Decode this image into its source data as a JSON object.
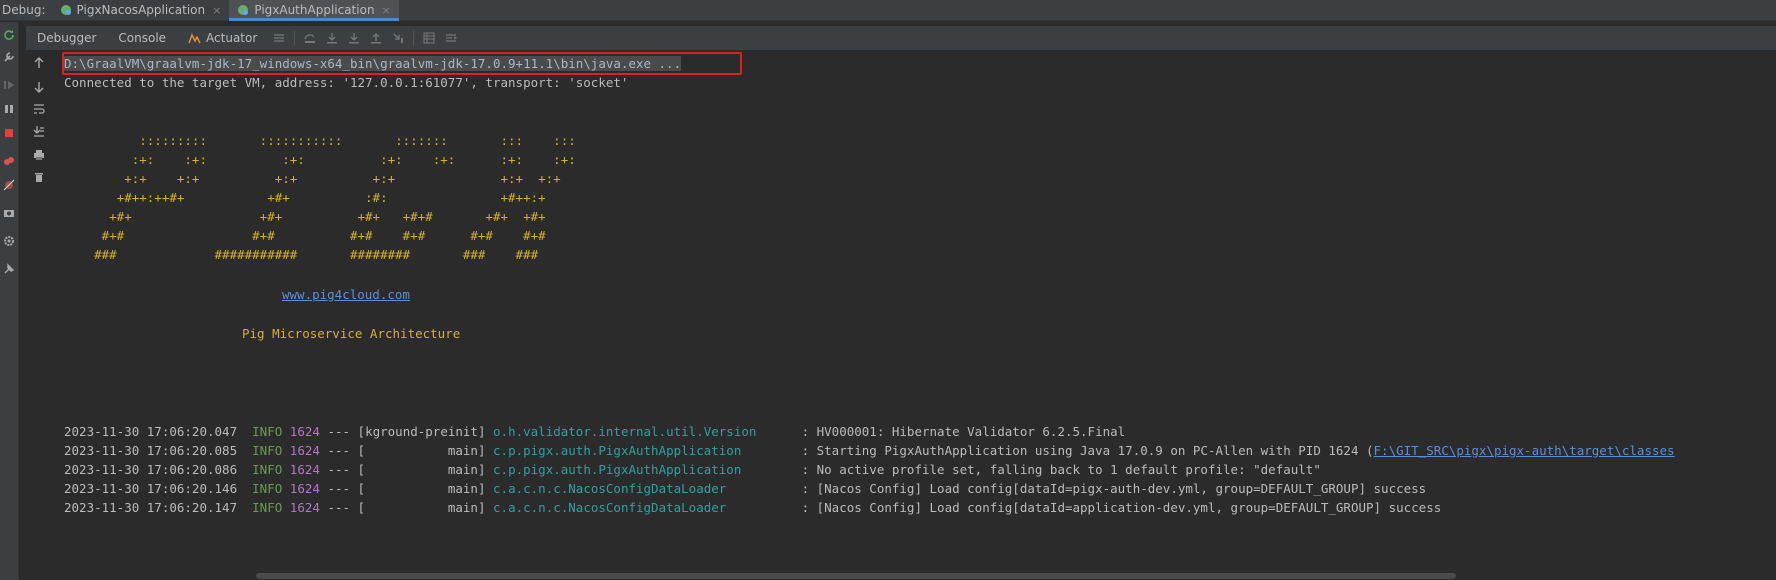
{
  "tabbar": {
    "debug_label": "Debug:",
    "tabs": [
      {
        "label": "PigxNacosApplication",
        "close": "×"
      },
      {
        "label": "PigxAuthApplication",
        "close": "×"
      }
    ]
  },
  "toolbar": {
    "tabs": [
      "Debugger",
      "Console",
      "Actuator"
    ]
  },
  "console": {
    "command": "D:\\GraalVM\\graalvm-jdk-17_windows-x64_bin\\graalvm-jdk-17.0.9+11.1\\bin\\java.exe ...",
    "connected": "Connected to the target VM, address: '127.0.0.1:61077', transport: 'socket'",
    "banner": [
      "          :::::::::       :::::::::::       :::::::       :::    :::",
      "         :+:    :+:          :+:          :+:    :+:      :+:    :+:",
      "        +:+    +:+          +:+          +:+              +:+  +:+",
      "       +#++:++#+           +#+          :#:               +#++:+",
      "      +#+                 +#+          +#+   +#+#       +#+  +#+",
      "     #+#                 #+#          #+#    #+#      #+#    #+#",
      "    ###             ###########       ########       ###    ###"
    ],
    "website": "www.pig4cloud.com",
    "tagline": "Pig Microservice Architecture",
    "logs": [
      {
        "ts": "2023-11-30 17:06:20.047",
        "level": "INFO",
        "pid": "1624",
        "sep": "---",
        "thread": "[kground-preinit]",
        "logger": "o.h.validator.internal.util.Version     ",
        "msg": ": HV000001: Hibernate Validator 6.2.5.Final",
        "link": ""
      },
      {
        "ts": "2023-11-30 17:06:20.085",
        "level": "INFO",
        "pid": "1624",
        "sep": "---",
        "thread": "[           main]",
        "logger": "c.p.pigx.auth.PigxAuthApplication       ",
        "msg": ": Starting PigxAuthApplication using Java 17.0.9 on PC-Allen with PID 1624 (",
        "link": "F:\\GIT_SRC\\pigx\\pigx-auth\\target\\classes"
      },
      {
        "ts": "2023-11-30 17:06:20.086",
        "level": "INFO",
        "pid": "1624",
        "sep": "---",
        "thread": "[           main]",
        "logger": "c.p.pigx.auth.PigxAuthApplication       ",
        "msg": ": No active profile set, falling back to 1 default profile: \"default\"",
        "link": ""
      },
      {
        "ts": "2023-11-30 17:06:20.146",
        "level": "INFO",
        "pid": "1624",
        "sep": "---",
        "thread": "[           main]",
        "logger": "c.a.c.n.c.NacosConfigDataLoader         ",
        "msg": ": [Nacos Config] Load config[dataId=pigx-auth-dev.yml, group=DEFAULT_GROUP] success",
        "link": ""
      },
      {
        "ts": "2023-11-30 17:06:20.147",
        "level": "INFO",
        "pid": "1624",
        "sep": "---",
        "thread": "[           main]",
        "logger": "c.a.c.n.c.NacosConfigDataLoader         ",
        "msg": ": [Nacos Config] Load config[dataId=application-dev.yml, group=DEFAULT_GROUP] success",
        "link": ""
      }
    ]
  },
  "colors": {
    "background": "#2b2b2b",
    "banner": "#d4b22a",
    "highlight_box": "#e02020",
    "info": "#6a9955",
    "pid": "#b574c8",
    "logger": "#31a0a0",
    "link": "#5c8fd6",
    "active_tab_underline": "#4a88c7"
  }
}
